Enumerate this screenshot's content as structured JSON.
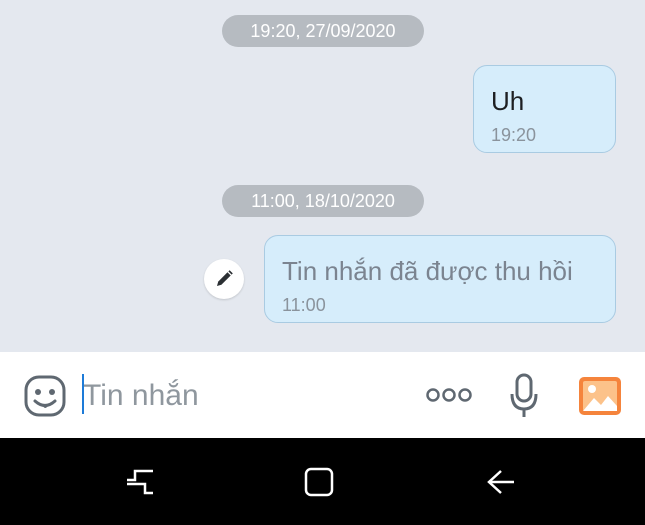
{
  "chat": {
    "groups": [
      {
        "date": "19:20, 27/09/2020",
        "message": "Uh",
        "time": "19:20"
      },
      {
        "date": "11:00, 18/10/2020",
        "message": "Tin nhắn đã được thu hồi",
        "time": "11:00",
        "recalled": true
      }
    ]
  },
  "composer": {
    "placeholder": "Tin nhắn",
    "icons": [
      "sticker-icon",
      "more-options-icon",
      "microphone-icon",
      "photo-gallery-icon"
    ]
  },
  "navbar": {
    "icons": [
      "recent-apps-icon",
      "home-icon",
      "back-icon"
    ]
  },
  "colors": {
    "chat_background": "#e4e8ef",
    "bubble_background": "#d6edfb",
    "bubble_border": "#a9cbe2",
    "date_pill": "#b6bbc1",
    "photo_icon": "#f5843c",
    "caret": "#1d7bd8"
  }
}
